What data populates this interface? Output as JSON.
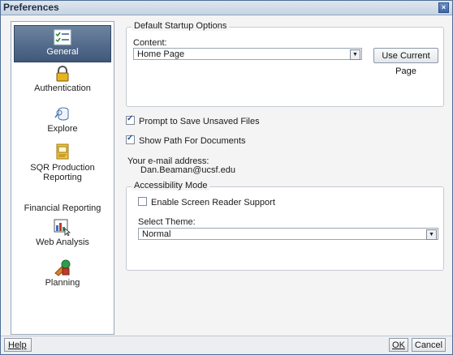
{
  "window": {
    "title": "Preferences",
    "close_glyph": "×"
  },
  "sidebar": {
    "items": [
      {
        "label": "General",
        "icon": "checklist-icon",
        "selected": true
      },
      {
        "label": "Authentication",
        "icon": "lock-icon",
        "selected": false
      },
      {
        "label": "Explore",
        "icon": "database-icon",
        "selected": false
      },
      {
        "label": "SQR Production Reporting",
        "icon": "report-icon",
        "selected": false
      },
      {
        "label": "Financial Reporting",
        "icon": "none",
        "selected": false
      },
      {
        "label": "Web Analysis",
        "icon": "chart-icon",
        "selected": false
      },
      {
        "label": "Planning",
        "icon": "planning-icon",
        "selected": false
      }
    ]
  },
  "startup": {
    "legend": "Default Startup Options",
    "content_label": "Content:",
    "content_value": "Home Page",
    "use_current_label": "Use Current Page"
  },
  "options": {
    "prompt_save_label": "Prompt to Save Unsaved Files",
    "prompt_save_checked": true,
    "show_path_label": "Show Path For Documents",
    "show_path_checked": true
  },
  "email": {
    "label": "Your e-mail address:",
    "value": "Dan.Beaman@ucsf.edu"
  },
  "accessibility": {
    "legend": "Accessibility Mode",
    "screen_reader_label": "Enable Screen Reader Support",
    "screen_reader_checked": false,
    "theme_label": "Select Theme:",
    "theme_value": "Normal"
  },
  "footer": {
    "help_label": "Help",
    "ok_label": "OK",
    "cancel_label": "Cancel"
  },
  "colors": {
    "accent": "#3f587a",
    "titlebar": "#c6d3e2",
    "border": "#4d6f96"
  }
}
